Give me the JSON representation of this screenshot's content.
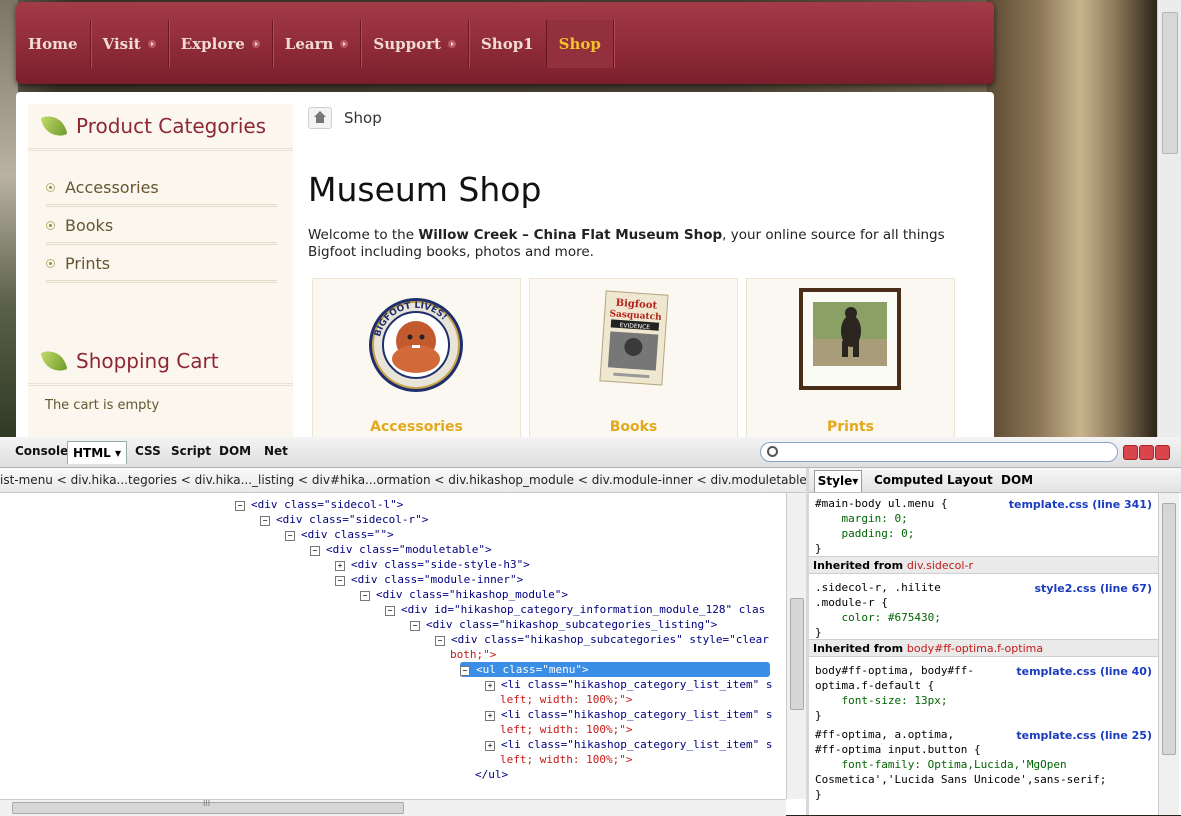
{
  "nav": {
    "items": [
      {
        "label": "Home",
        "arrow": false
      },
      {
        "label": "Visit",
        "arrow": true
      },
      {
        "label": "Explore",
        "arrow": true
      },
      {
        "label": "Learn",
        "arrow": true
      },
      {
        "label": "Support",
        "arrow": true
      },
      {
        "label": "Shop1",
        "arrow": false
      },
      {
        "label": "Shop",
        "arrow": false,
        "active": true
      }
    ]
  },
  "sidebar": {
    "categories_title": "Product Categories",
    "categories": [
      "Accessories",
      "Books",
      "Prints"
    ],
    "cart_title": "Shopping Cart",
    "cart_empty": "The cart is empty"
  },
  "main": {
    "breadcrumb": "Shop",
    "title": "Museum Shop",
    "intro_prefix": "Welcome to the ",
    "intro_bold": "Willow Creek – China Flat Museum Shop",
    "intro_suffix": ", your online source for all things Bigfoot including books, photos and more.",
    "cards": [
      "Accessories",
      "Books",
      "Prints"
    ],
    "badge_text": "BIGFOOT LIVES!",
    "book_title_1": "Bigfoot",
    "book_title_2": "Sasquatch",
    "book_title_3": "EVIDENCE"
  },
  "firebug": {
    "tabs": [
      "Console",
      "HTML",
      "CSS",
      "Script",
      "DOM",
      "Net"
    ],
    "breadcrumbs": "ist-menu < div.hika...tegories < div.hika..._listing < div#hika...ormation < div.hikashop_module < div.module-inner < div.moduletable < div < div.si▸",
    "side_tabs": [
      "Style",
      "Computed",
      "Layout",
      "DOM"
    ],
    "tree": [
      {
        "indent": 0,
        "tog": "−",
        "text": "<div class=\"sidecol-l\">"
      },
      {
        "indent": 1,
        "tog": "−",
        "text": "<div class=\"sidecol-r\">"
      },
      {
        "indent": 2,
        "tog": "−",
        "text": "<div class=\"\">"
      },
      {
        "indent": 3,
        "tog": "−",
        "text": "<div class=\"moduletable\">"
      },
      {
        "indent": 4,
        "tog": "+",
        "text": "<div class=\"side-style-h3\">"
      },
      {
        "indent": 4,
        "tog": "−",
        "text": "<div class=\"module-inner\">"
      },
      {
        "indent": 5,
        "tog": "−",
        "text": "<div class=\"hikashop_module\">"
      },
      {
        "indent": 6,
        "tog": "−",
        "text": "<div id=\"hikashop_category_information_module_128\" clas"
      },
      {
        "indent": 7,
        "tog": "−",
        "text": "<div class=\"hikashop_subcategories_listing\">"
      },
      {
        "indent": 8,
        "tog": "−",
        "text": "<div class=\"hikashop_subcategories\" style=\"clear"
      },
      {
        "indent": 8,
        "tog": "",
        "text": "both;\">"
      },
      {
        "indent": 9,
        "tog": "−",
        "text": "<ul class=\"menu\">",
        "selected": true
      },
      {
        "indent": 10,
        "tog": "+",
        "text": "<li class=\"hikashop_category_list_item\" s"
      },
      {
        "indent": 10,
        "tog": "",
        "text": "left; width: 100%;\">"
      },
      {
        "indent": 10,
        "tog": "+",
        "text": "<li class=\"hikashop_category_list_item\" s"
      },
      {
        "indent": 10,
        "tog": "",
        "text": "left; width: 100%;\">"
      },
      {
        "indent": 10,
        "tog": "+",
        "text": "<li class=\"hikashop_category_list_item\" s"
      },
      {
        "indent": 10,
        "tog": "",
        "text": "left; width: 100%;\">"
      },
      {
        "indent": 9,
        "tog": "",
        "text": "</ul>"
      }
    ],
    "rules": {
      "r1_sel": "#main-body ul.menu {",
      "r1_src": "template.css (line 341)",
      "r1_p1": "    margin: 0;",
      "r1_p2": "    padding: 0;",
      "r1_end": "}",
      "inh1_label": "Inherited from ",
      "inh1_el": "div.sidecol-r",
      "r2_sel1": ".sidecol-r, .hilite",
      "r2_sel2": ".module-r {",
      "r2_src": "style2.css (line 67)",
      "r2_p1": "    color: #675430;",
      "r2_end": "}",
      "inh2_label": "Inherited from ",
      "inh2_el": "body#ff-optima.f-optima",
      "r3_sel1": "body#ff-optima, body#ff-",
      "r3_sel2": "optima.f-default {",
      "r3_src": "template.css (line 40)",
      "r3_p1": "    font-size: 13px;",
      "r3_end": "}",
      "r4_sel1": "#ff-optima, a.optima,",
      "r4_sel2": "#ff-optima input.button {",
      "r4_src": "template.css (line 25)",
      "r4_p1": "    font-family: Optima,Lucida,'MgOpen",
      "r4_p2": "Cosmetica','Lucida Sans Unicode',sans-serif;",
      "r4_end": "}"
    },
    "hscroll_grip": "III"
  },
  "colors": {
    "nav": "#8f2b38",
    "active": "#f3c12a",
    "heading": "#8e2634",
    "link": "#675430",
    "card_label": "#e3a81c",
    "select": "#3a8ee6"
  }
}
